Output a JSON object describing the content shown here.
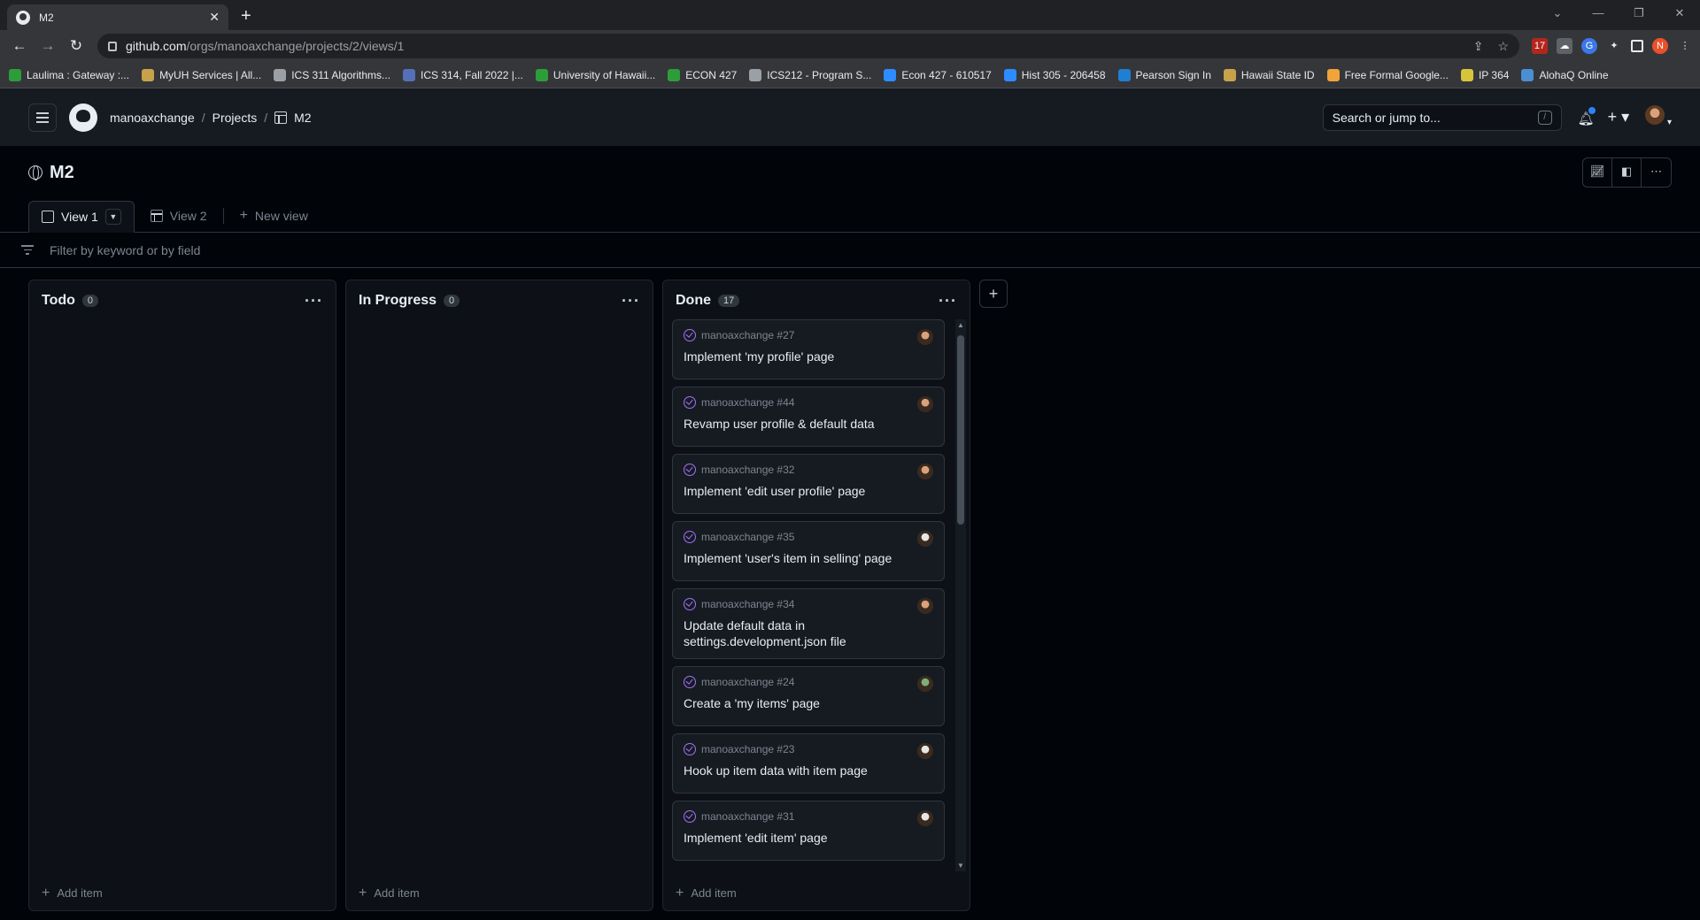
{
  "browser": {
    "tab_title": "M2",
    "url_host": "github.com",
    "url_path": "/orgs/manoaxchange/projects/2/views/1",
    "bookmarks": [
      "Laulima : Gateway :...",
      "MyUH Services | All...",
      "ICS 311 Algorithms...",
      "ICS 314, Fall 2022 |...",
      "University of Hawaii...",
      "ECON 427",
      "ICS212 - Program S...",
      "Econ 427 - 610517",
      "Hist 305 - 206458",
      "Pearson Sign In",
      "Hawaii State ID",
      "Free Formal Google...",
      "IP 364",
      "AlohaQ Online"
    ],
    "bookmark_colors": [
      "#2d9d3a",
      "#c8a24a",
      "#9aa0a6",
      "#5470b8",
      "#2d9d3a",
      "#2d9d3a",
      "#9aa0a6",
      "#2d8cff",
      "#2d8cff",
      "#1f7fd1",
      "#c8a24a",
      "#f2a33a",
      "#d8c43a",
      "#4a8fd1"
    ]
  },
  "header": {
    "org": "manoaxchange",
    "projects": "Projects",
    "project": "M2",
    "search_placeholder": "Search or jump to...",
    "search_key": "/"
  },
  "project": {
    "title": "M2",
    "views": [
      "View 1",
      "View 2"
    ],
    "new_view": "New view",
    "filter_placeholder": "Filter by keyword or by field"
  },
  "columns": [
    {
      "name": "Todo",
      "count": "0",
      "add": "Add item"
    },
    {
      "name": "In Progress",
      "count": "0",
      "add": "Add item"
    },
    {
      "name": "Done",
      "count": "17",
      "add": "Add item"
    }
  ],
  "cards": [
    {
      "ref": "manoaxchange #27",
      "title": "Implement 'my profile' page",
      "avatar": "#d9a27c"
    },
    {
      "ref": "manoaxchange #44",
      "title": "Revamp user profile & default data",
      "avatar": "#d9a27c"
    },
    {
      "ref": "manoaxchange #32",
      "title": "Implement 'edit user profile' page",
      "avatar": "#d9a27c"
    },
    {
      "ref": "manoaxchange #35",
      "title": "Implement 'user's item in selling' page",
      "avatar": "#e6e6e6"
    },
    {
      "ref": "manoaxchange #34",
      "title": "Update default data in settings.development.json file",
      "avatar": "#d9a27c"
    },
    {
      "ref": "manoaxchange #24",
      "title": "Create a 'my items' page",
      "avatar": "#7fae7a"
    },
    {
      "ref": "manoaxchange #23",
      "title": "Hook up item data with item page",
      "avatar": "#e6e6e6"
    },
    {
      "ref": "manoaxchange #31",
      "title": "Implement 'edit item' page",
      "avatar": "#e6e6e6"
    }
  ]
}
